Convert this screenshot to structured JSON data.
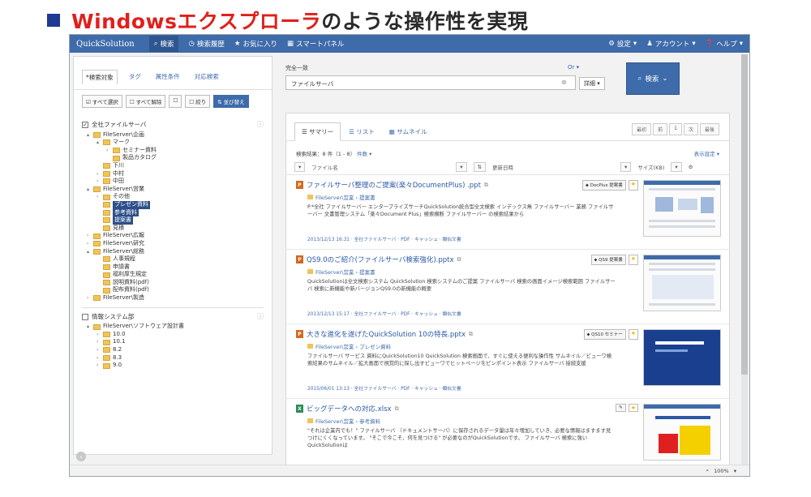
{
  "slide": {
    "title_red": "Windowsエクスプローラ",
    "title_dark": "のような操作性を実現"
  },
  "navbar": {
    "brand": "QuickSolution",
    "items": [
      "検索",
      "検索履歴",
      "お気に入り",
      "スマートパネル"
    ],
    "right_items": [
      "設定",
      "アカウント",
      "ヘルプ"
    ]
  },
  "left": {
    "tabs": [
      "*検索対象",
      "タグ",
      "属性条件",
      "対応検索"
    ],
    "select_buttons": [
      "すべて選択",
      "すべて解除",
      "",
      "絞り",
      "並び替え"
    ],
    "tree1_root": "全社ファイルサーバ",
    "tree1": [
      {
        "label": "FileServer\\企画",
        "depth": 0,
        "caret": "▴"
      },
      {
        "label": "マーク",
        "depth": 1,
        "caret": "▴"
      },
      {
        "label": "セミナー資料",
        "depth": 2,
        "caret": "›"
      },
      {
        "label": "製品カタログ",
        "depth": 2,
        "caret": ""
      },
      {
        "label": "下川",
        "depth": 1,
        "caret": ""
      },
      {
        "label": "中村",
        "depth": 1,
        "caret": "›"
      },
      {
        "label": "中田",
        "depth": 1,
        "caret": "›"
      },
      {
        "label": "FileServer\\営業",
        "depth": 0,
        "caret": "▴"
      },
      {
        "label": "その他",
        "depth": 1,
        "caret": "›"
      },
      {
        "label": "プレゼン資料",
        "depth": 1,
        "caret": "",
        "selected": true
      },
      {
        "label": "参考資料",
        "depth": 1,
        "caret": "",
        "selected": true
      },
      {
        "label": "提案書",
        "depth": 1,
        "caret": "",
        "selected": true
      },
      {
        "label": "見積",
        "depth": 1,
        "caret": ""
      },
      {
        "label": "FileServer\\広報",
        "depth": 0,
        "caret": "›"
      },
      {
        "label": "FileServer\\研究",
        "depth": 0,
        "caret": "›"
      },
      {
        "label": "FileServer\\総務",
        "depth": 0,
        "caret": "▴"
      },
      {
        "label": "人事規程",
        "depth": 1,
        "caret": ""
      },
      {
        "label": "申請書",
        "depth": 1,
        "caret": ""
      },
      {
        "label": "福利厚生規定",
        "depth": 1,
        "caret": ""
      },
      {
        "label": "説明資料(pdf)",
        "depth": 1,
        "caret": ""
      },
      {
        "label": "配布資料(pdf)",
        "depth": 1,
        "caret": ""
      },
      {
        "label": "FileServer\\製造",
        "depth": 0,
        "caret": "›"
      }
    ],
    "tree2_root": "情報システム部",
    "tree2": [
      {
        "label": "FileServer\\ソフトウェア設計書",
        "depth": 0,
        "caret": "▴"
      },
      {
        "label": "10.0",
        "depth": 1,
        "caret": "›"
      },
      {
        "label": "10.1",
        "depth": 1,
        "caret": "›"
      },
      {
        "label": "8.2",
        "depth": 1,
        "caret": "›"
      },
      {
        "label": "8.3",
        "depth": 1,
        "caret": "›"
      },
      {
        "label": "9.0",
        "depth": 1,
        "caret": "›"
      }
    ]
  },
  "search": {
    "mode": "完全一致",
    "or_label": "Or",
    "query": "ファイルサーバ",
    "detail_label": "詳細",
    "button_label": "検索"
  },
  "results": {
    "tabs": [
      "サマリー",
      "リスト",
      "サムネイル"
    ],
    "pager": [
      "最初",
      "前",
      "1",
      "次",
      "最後"
    ],
    "count_text": "検索結果：8 件（1 - 8）",
    "sort_label": "件数",
    "display_settings": "表示設定",
    "columns": [
      "ファイル名",
      "更新日時",
      "サイズ(KB)"
    ],
    "items": [
      {
        "type": "P",
        "title": "ファイルサーバ整理のご提案(楽々DocumentPlus) .ppt",
        "tag": "DocPlus 提案書",
        "path": "FileServer\\営業 › 提案書",
        "snippet": "P.*全社 ファイルサーバー エンタープライズサーチQuickSolution統合型全文検索 インデックス無 ファイルサーバー 業務 ファイルサーバー 文書管理システム「楽々Document Plus」検索横断 ファイルサーバー の検索結果から",
        "foot": "2013/12/13 16:31 · 全社ファイルサーバ · PDF · キャッシュ · 類似文書"
      },
      {
        "type": "P",
        "title": "QS9.0のご紹介(ファイルサーバ検索強化).pptx",
        "tag": "QS9 提案書",
        "path": "FileServer\\営業 › 提案書",
        "snippet": "QuickSolutionは全文検索システム QuickSolution 検索システムのご提案 ファイルサーバ 検索の画面イメージ検索範囲 ファイルサーバ 検索に新機能や新バージョンQS9.0の新機能の概要",
        "foot": "2013/12/13 15:17 · 全社ファイルサーバ · PDF · キャッシュ · 類似文書"
      },
      {
        "type": "P",
        "title": "大きな進化を遂げたQuickSolution 10の特長.pptx",
        "tag": "QS10 セミナー",
        "path": "FileServer\\営業 › プレゼン資料",
        "snippet": "ファイルサーバ サービス 資料にQuickSolution10 QuickSolution 検索画面で、すぐに使える便利な操作性 サムネイル／ビューワ検索結果のサムネイル／拡大画面で視覚的に探し出すビューワでヒットページをピンポイント表示 ファイルサーバ 接続支援",
        "foot": "2015/06/01 13:13 · 全社ファイルサーバ · PDF · キャッシュ · 類似文書"
      },
      {
        "type": "X",
        "title": "ビッグデータへの対応.xlsx",
        "tag": "",
        "path": "FileServer\\営業 › 参考資料",
        "snippet": "\"それは企業内でも！\" ファイルサーバ （ドキュメントサーバ）に保存されるデータ量は年々増加していき、必要な情報はますます見つけにくくなっています。 \"そこで今こそ、何を見つける\" が必要なのがQuickSolutionです。 ファイルサーバ 検索に強いQuickSolutionは",
        "foot": ""
      }
    ]
  },
  "status": {
    "zoom": "100%"
  },
  "colors": {
    "accent": "#3e6baa",
    "title_red": "#e0201b"
  }
}
